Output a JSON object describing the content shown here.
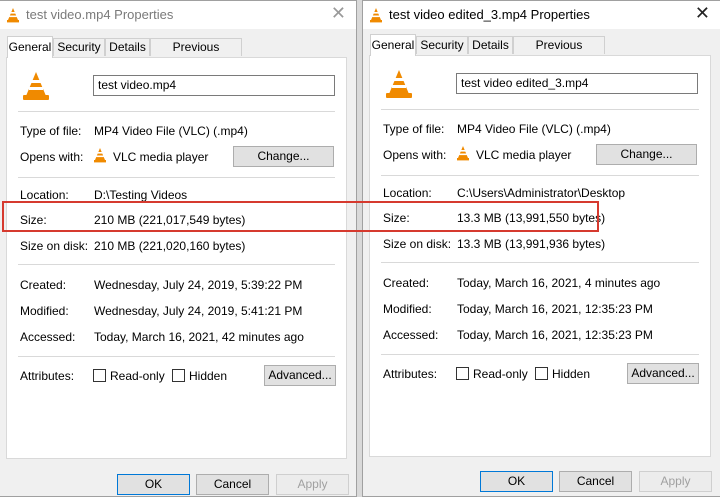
{
  "left": {
    "title": "test video.mp4 Properties",
    "tabs": [
      "General",
      "Security",
      "Details",
      "Previous Versions"
    ],
    "filename": "test video.mp4",
    "type_label": "Type of file:",
    "type_value": "MP4 Video File (VLC) (.mp4)",
    "opens_label": "Opens with:",
    "opens_value": "VLC media player",
    "change_button": "Change...",
    "location_label": "Location:",
    "location_value": "D:\\Testing Videos",
    "size_label": "Size:",
    "size_value": "210 MB (221,017,549 bytes)",
    "disk_label": "Size on disk:",
    "disk_value": "210 MB (221,020,160 bytes)",
    "created_label": "Created:",
    "created_value": "Wednesday, July 24, 2019, 5:39:22 PM",
    "modified_label": "Modified:",
    "modified_value": "Wednesday, July 24, 2019, 5:41:21 PM",
    "accessed_label": "Accessed:",
    "accessed_value": "Today, March 16, 2021, 42 minutes ago",
    "attributes_label": "Attributes:",
    "readonly_label": "Read-only",
    "hidden_label": "Hidden",
    "advanced_button": "Advanced...",
    "ok_button": "OK",
    "cancel_button": "Cancel",
    "apply_button": "Apply"
  },
  "right": {
    "title": "test video edited_3.mp4 Properties",
    "tabs": [
      "General",
      "Security",
      "Details",
      "Previous Versions"
    ],
    "filename": "test video edited_3.mp4",
    "type_label": "Type of file:",
    "type_value": "MP4 Video File (VLC) (.mp4)",
    "opens_label": "Opens with:",
    "opens_value": "VLC media player",
    "change_button": "Change...",
    "location_label": "Location:",
    "location_value": "C:\\Users\\Administrator\\Desktop",
    "size_label": "Size:",
    "size_value": "13.3 MB (13,991,550 bytes)",
    "disk_label": "Size on disk:",
    "disk_value": "13.3 MB (13,991,936 bytes)",
    "created_label": "Created:",
    "created_value": "Today, March 16, 2021, 4 minutes ago",
    "modified_label": "Modified:",
    "modified_value": "Today, March 16, 2021, 12:35:23 PM",
    "accessed_label": "Accessed:",
    "accessed_value": "Today, March 16, 2021, 12:35:23 PM",
    "attributes_label": "Attributes:",
    "readonly_label": "Read-only",
    "hidden_label": "Hidden",
    "advanced_button": "Advanced...",
    "ok_button": "OK",
    "cancel_button": "Cancel",
    "apply_button": "Apply"
  },
  "colors": {
    "highlight": "#d63a2f",
    "vlc_orange": "#f08a00"
  },
  "icons": {
    "file": "vlc-cone-icon",
    "close": "close-icon"
  }
}
